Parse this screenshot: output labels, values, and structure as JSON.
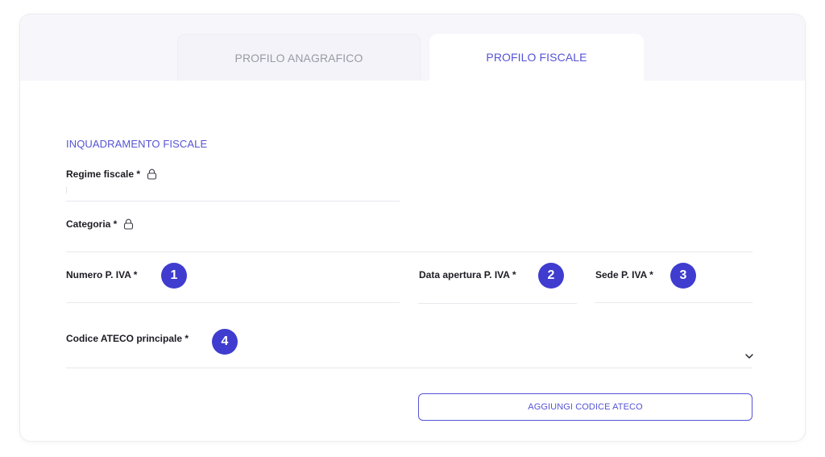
{
  "tabs": {
    "anagrafico": "PROFILO ANAGRAFICO",
    "fiscale": "PROFILO FISCALE"
  },
  "section": {
    "title": "INQUADRAMENTO FISCALE"
  },
  "fields": {
    "regime": {
      "label": "Regime fiscale *",
      "value": ""
    },
    "categoria": {
      "label": "Categoria *",
      "value": ""
    },
    "numero_iva": {
      "label": "Numero P. IVA *",
      "value": ""
    },
    "data_apertura": {
      "label": "Data apertura P. IVA *",
      "value": ""
    },
    "sede_iva": {
      "label": "Sede P. IVA *",
      "value": ""
    },
    "codice_ateco": {
      "label": "Codice ATECO principale *",
      "value": ""
    }
  },
  "badges": {
    "b1": "1",
    "b2": "2",
    "b3": "3",
    "b4": "4"
  },
  "buttons": {
    "add_ateco": "AGGIUNGI CODICE ATECO"
  },
  "colors": {
    "accent": "#5553d6",
    "badge": "#3f3ccf",
    "text": "#1c1c24",
    "muted": "#9a9aa5"
  }
}
